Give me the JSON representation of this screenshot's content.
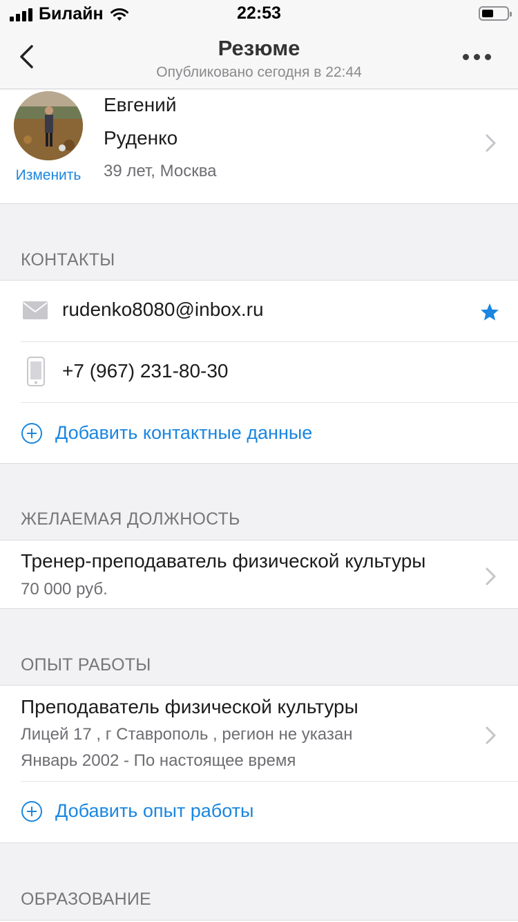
{
  "status_bar": {
    "carrier": "Билайн",
    "time": "22:53"
  },
  "nav": {
    "title": "Резюме",
    "subtitle": "Опубликовано сегодня в 22:44"
  },
  "profile": {
    "first_name": "Евгений",
    "last_name": "Руденко",
    "meta": "39 лет, Москва",
    "change_label": "Изменить"
  },
  "contacts": {
    "section_title": "КОНТАКТЫ",
    "email": "rudenko8080@inbox.ru",
    "phone": "+7 (967) 231-80-30",
    "add_label": "Добавить контактные данные"
  },
  "position": {
    "section_title": "ЖЕЛАЕМАЯ ДОЛЖНОСТЬ",
    "title": "Тренер-преподаватель физической культуры",
    "salary": "70 000 руб."
  },
  "experience": {
    "section_title": "ОПЫТ РАБОТЫ",
    "job_title": "Преподаватель физической культуры",
    "place": "Лицей 17 , г Ставрополь , регион не указан",
    "period": "Январь 2002 - По настоящее время",
    "add_label": "Добавить опыт работы"
  },
  "education": {
    "section_title": "ОБРАЗОВАНИЕ"
  },
  "colors": {
    "accent": "#1a86e0",
    "section_text": "#777777",
    "background": "#f2f2f4"
  },
  "icons": [
    "back-chevron-icon",
    "more-icon",
    "mail-icon",
    "phone-icon",
    "star-icon",
    "plus-circle-icon",
    "chevron-right-icon"
  ]
}
